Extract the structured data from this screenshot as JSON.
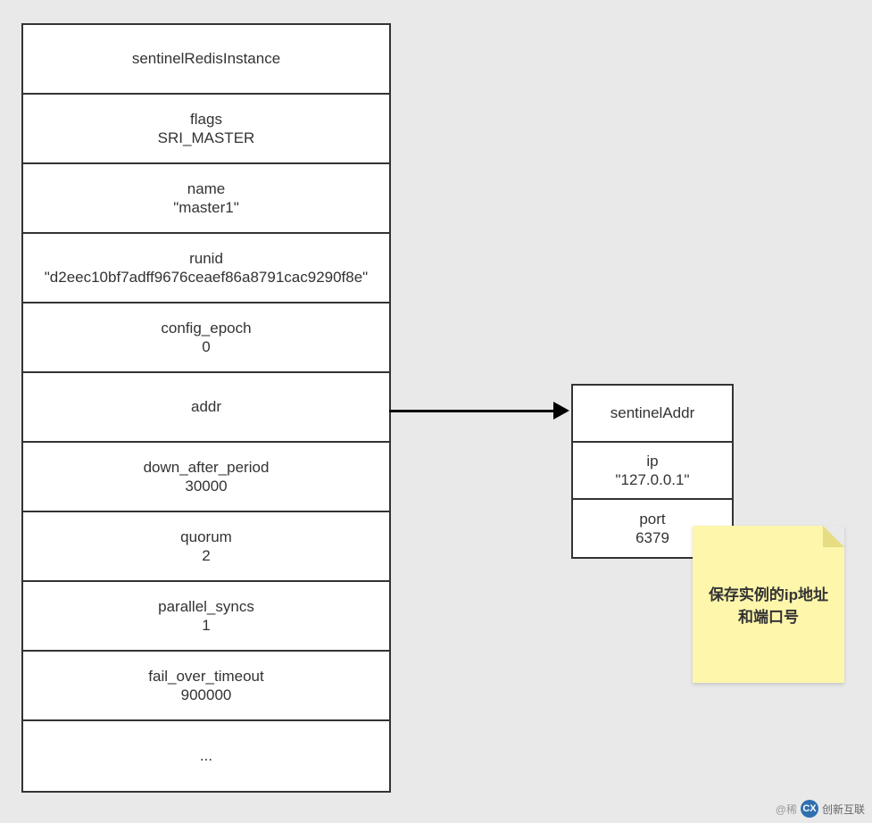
{
  "left_table": {
    "header": "sentinelRedisInstance",
    "rows": [
      {
        "name": "flags",
        "value": "SRI_MASTER"
      },
      {
        "name": "name",
        "value": "\"master1\""
      },
      {
        "name": "runid",
        "value": "\"d2eec10bf7adff9676ceaef86a8791cac9290f8e\""
      },
      {
        "name": "config_epoch",
        "value": "0"
      },
      {
        "name": "addr",
        "value": ""
      },
      {
        "name": "down_after_period",
        "value": "30000"
      },
      {
        "name": "quorum",
        "value": "2"
      },
      {
        "name": "parallel_syncs",
        "value": "1"
      },
      {
        "name": "fail_over_timeout",
        "value": "900000"
      },
      {
        "name": "...",
        "value": ""
      }
    ]
  },
  "right_table": {
    "header": "sentinelAddr",
    "rows": [
      {
        "name": "ip",
        "value": "\"127.0.0.1\""
      },
      {
        "name": "port",
        "value": "6379"
      }
    ]
  },
  "sticky_note": "保存实例的ip地址和端口号",
  "watermark": {
    "prefix": "@稀",
    "brand": "创新互联"
  }
}
